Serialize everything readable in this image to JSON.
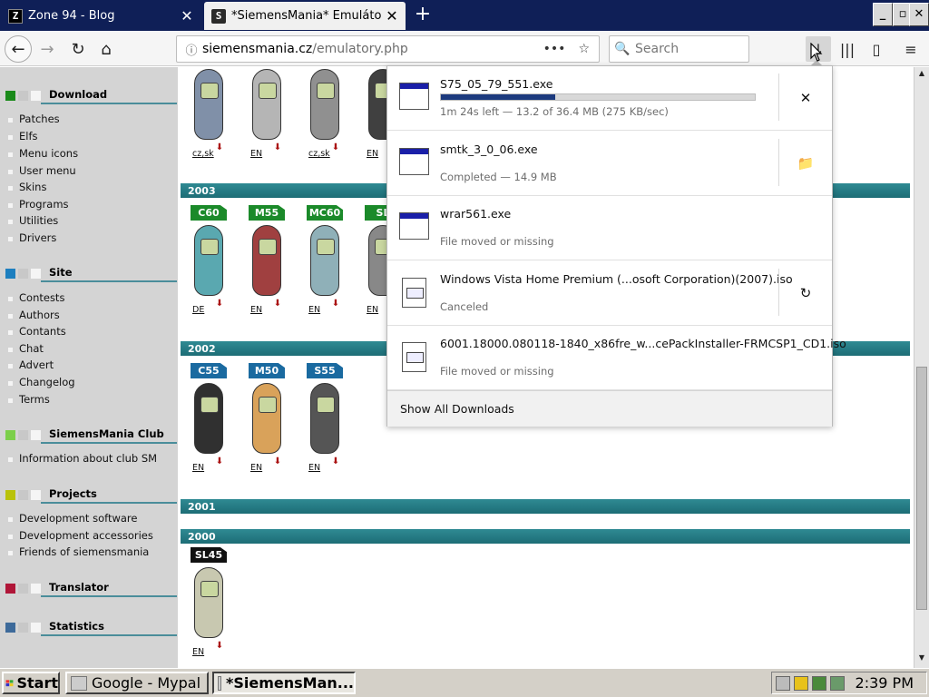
{
  "browser": {
    "tabs": [
      {
        "favicon": "Z",
        "title": "Zone 94 - Blog",
        "close": "✕"
      },
      {
        "favicon": "S",
        "title": "*SiemensMania* Emulátory",
        "close": "✕"
      }
    ],
    "new_tab": "+",
    "window_buttons": {
      "minimize": "_",
      "maximize": "▫",
      "close": "✕"
    },
    "nav": {
      "back": "←",
      "forward": "→",
      "reload": "↻",
      "home": "⌂"
    },
    "url": {
      "host": "siemensmania.cz",
      "path": "/emulatory.php",
      "info": "ⓘ",
      "more": "•••",
      "bookmark": "☆"
    },
    "search": {
      "placeholder": "Search",
      "icon": "🔍"
    },
    "toolbar": {
      "downloads": "↓",
      "library": "|||",
      "sidebar": "▯",
      "menu": "≡"
    }
  },
  "sidebar": {
    "sections": [
      {
        "title": "Download",
        "color": "#1a8a1a",
        "items": [
          "Patches",
          "Elfs",
          "Menu icons",
          "User menu",
          "Skins",
          "Programs",
          "Utilities",
          "Drivers"
        ]
      },
      {
        "title": "Site",
        "color": "#1d7fbf",
        "items": [
          "Contests",
          "Authors",
          "Contants",
          "Chat",
          "Advert",
          "Changelog",
          "Terms"
        ]
      },
      {
        "title": "SiemensMania Club",
        "color": "#7ccf4a",
        "items": [
          "Information about club SM"
        ]
      },
      {
        "title": "Projects",
        "color": "#b9c20a",
        "items": [
          "Development software",
          "Development accessories",
          "Friends of siemensmania"
        ]
      },
      {
        "title": "Translator",
        "color": "#b01638",
        "items": []
      },
      {
        "title": "Statistics",
        "color": "#3d6a9a",
        "items": []
      }
    ]
  },
  "content": {
    "rows": [
      {
        "year": "",
        "phones": [
          {
            "model": "",
            "lang": "cz,sk",
            "color": "#8090a8"
          },
          {
            "model": "",
            "lang": "EN",
            "color": "#b5b5b5"
          },
          {
            "model": "",
            "lang": "cz,sk",
            "color": "#909090"
          },
          {
            "model": "",
            "lang": "EN",
            "color": "#404040"
          }
        ]
      },
      {
        "year": "2003",
        "phones": [
          {
            "model": "C60",
            "lang": "DE",
            "badge_color": "#1b8a2a",
            "color": "#5aa8b0"
          },
          {
            "model": "M55",
            "lang": "EN",
            "badge_color": "#1b8a2a",
            "color": "#a04040"
          },
          {
            "model": "MC60",
            "lang": "EN",
            "badge_color": "#1b8a2a",
            "color": "#8fb0b8"
          },
          {
            "model": "SL",
            "lang": "EN",
            "badge_color": "#1b8a2a",
            "color": "#888"
          }
        ]
      },
      {
        "year": "2002",
        "phones": [
          {
            "model": "C55",
            "lang": "EN",
            "badge_color": "#1a6aa0",
            "color": "#303030"
          },
          {
            "model": "M50",
            "lang": "EN",
            "badge_color": "#1a6aa0",
            "color": "#d9a25a"
          },
          {
            "model": "S55",
            "lang": "EN",
            "badge_color": "#1a6aa0",
            "color": "#555"
          }
        ]
      },
      {
        "year": "2001",
        "phones": []
      },
      {
        "year": "2000",
        "phones": [
          {
            "model": "SL45",
            "lang": "EN",
            "badge_color": "#111",
            "color": "#c8c8b0"
          }
        ]
      }
    ]
  },
  "downloads": {
    "items": [
      {
        "name": "S75_05_79_551.exe",
        "status": "1m 24s left — 13.2 of 36.4 MB (275 KB/sec)",
        "progress": 0.363,
        "icon": "exe",
        "action": "✕",
        "action_name": "cancel-download-button"
      },
      {
        "name": "smtk_3_0_06.exe",
        "status": "Completed — 14.9 MB",
        "icon": "exe",
        "action": "📁",
        "action_name": "open-folder-button"
      },
      {
        "name": "wrar561.exe",
        "status": "File moved or missing",
        "icon": "exe",
        "action": "",
        "action_name": ""
      },
      {
        "name": "Windows Vista Home Premium (...osoft Corporation)(2007).iso",
        "status": "Canceled",
        "icon": "iso",
        "action": "↻",
        "action_name": "retry-download-button"
      },
      {
        "name": "6001.18000.080118-1840_x86fre_w...cePackInstaller-FRMCSP1_CD1.iso",
        "status": "File moved or missing",
        "icon": "iso",
        "action": "",
        "action_name": ""
      }
    ],
    "footer": "Show All Downloads"
  },
  "taskbar": {
    "start": "Start",
    "tasks": [
      "Google - Mypal",
      "*SiemensMan..."
    ],
    "clock": "2:39 PM"
  }
}
